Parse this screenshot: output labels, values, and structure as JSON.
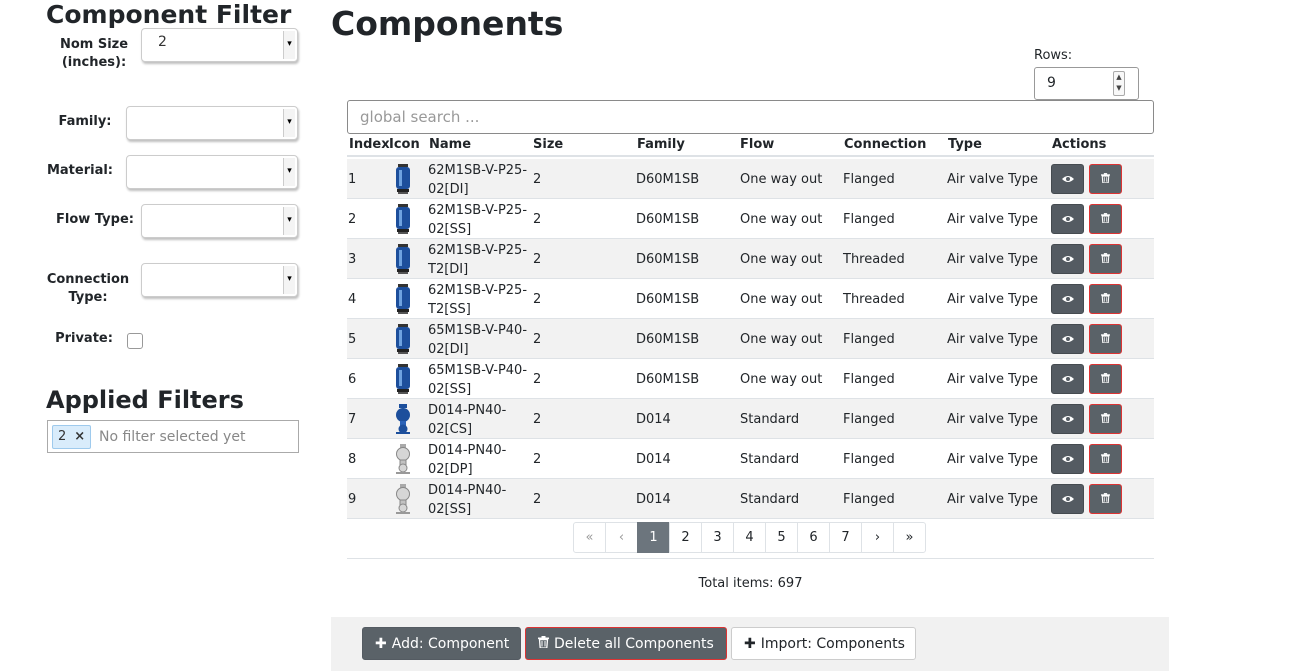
{
  "sidebar": {
    "title": "Component Filter",
    "filters": {
      "nom_size": {
        "label": "Nom Size (inches):",
        "value": "2"
      },
      "family": {
        "label": "Family:",
        "value": ""
      },
      "material": {
        "label": "Material:",
        "value": ""
      },
      "flow_type": {
        "label": "Flow Type:",
        "value": ""
      },
      "connection_type": {
        "label": "Connection Type:",
        "value": ""
      },
      "private": {
        "label": "Private:",
        "checked": false
      }
    },
    "applied": {
      "title": "Applied Filters",
      "chip_value": "2",
      "chip_remove": "×",
      "placeholder": "No filter selected yet"
    }
  },
  "main": {
    "title": "Components",
    "rows_label": "Rows:",
    "rows_value": "9",
    "search_placeholder": "global search ...",
    "columns": [
      "Index",
      "Icon",
      "Name",
      "Size",
      "Family",
      "Flow",
      "Connection",
      "Type",
      "Actions"
    ],
    "rows": [
      {
        "index": "1",
        "icon": "blue-valve-icon",
        "name": "62M1SB-V-P25-02[DI]",
        "size": "2",
        "family": "D60M1SB",
        "flow": "One way out",
        "connection": "Flanged",
        "type": "Air valve Type"
      },
      {
        "index": "2",
        "icon": "blue-valve-icon",
        "name": "62M1SB-V-P25-02[SS]",
        "size": "2",
        "family": "D60M1SB",
        "flow": "One way out",
        "connection": "Flanged",
        "type": "Air valve Type"
      },
      {
        "index": "3",
        "icon": "blue-valve-icon",
        "name": "62M1SB-V-P25-T2[DI]",
        "size": "2",
        "family": "D60M1SB",
        "flow": "One way out",
        "connection": "Threaded",
        "type": "Air valve Type"
      },
      {
        "index": "4",
        "icon": "blue-valve-icon",
        "name": "62M1SB-V-P25-T2[SS]",
        "size": "2",
        "family": "D60M1SB",
        "flow": "One way out",
        "connection": "Threaded",
        "type": "Air valve Type"
      },
      {
        "index": "5",
        "icon": "blue-valve-icon",
        "name": "65M1SB-V-P40-02[DI]",
        "size": "2",
        "family": "D60M1SB",
        "flow": "One way out",
        "connection": "Flanged",
        "type": "Air valve Type"
      },
      {
        "index": "6",
        "icon": "blue-valve-icon",
        "name": "65M1SB-V-P40-02[SS]",
        "size": "2",
        "family": "D60M1SB",
        "flow": "One way out",
        "connection": "Flanged",
        "type": "Air valve Type"
      },
      {
        "index": "7",
        "icon": "blue-d014-valve-icon",
        "name": "D014-PN40-02[CS]",
        "size": "2",
        "family": "D014",
        "flow": "Standard",
        "connection": "Flanged",
        "type": "Air valve Type"
      },
      {
        "index": "8",
        "icon": "grey-d014-valve-icon",
        "name": "D014-PN40-02[DP]",
        "size": "2",
        "family": "D014",
        "flow": "Standard",
        "connection": "Flanged",
        "type": "Air valve Type"
      },
      {
        "index": "9",
        "icon": "grey-d014-valve-icon",
        "name": "D014-PN40-02[SS]",
        "size": "2",
        "family": "D014",
        "flow": "Standard",
        "connection": "Flanged",
        "type": "Air valve Type"
      }
    ],
    "action_icons": {
      "view": "eye-icon",
      "delete": "trash-icon"
    },
    "pagination": {
      "first": "«",
      "prev": "‹",
      "pages": [
        "1",
        "2",
        "3",
        "4",
        "5",
        "6",
        "7"
      ],
      "active_page": "1",
      "next": "›",
      "last": "»"
    },
    "total": "Total items: 697"
  },
  "footer": {
    "add_icon": "plus-icon",
    "add_label": "Add: Component",
    "delete_icon": "trash-icon",
    "delete_label": "Delete all Components",
    "import_icon": "plus-icon",
    "import_label": "Import: Components"
  },
  "colors": {
    "button_dark": "#5a6268",
    "danger_border": "#dd3333",
    "active_page": "#6c757d",
    "valve_blue": "#1d4f9c",
    "chip_bg": "#d9ecfb"
  }
}
